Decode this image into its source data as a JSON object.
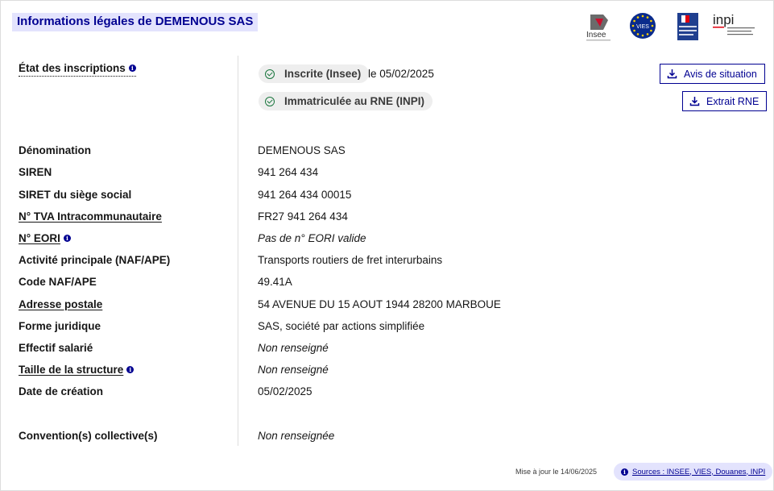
{
  "header": {
    "title": "Informations légales de DEMENOUS SAS",
    "logos": {
      "insee": "Insee",
      "vies": "VIES",
      "douanes": "DOUANES & DROITS INDIRECTS",
      "inpi": "inpi"
    }
  },
  "inscriptions": {
    "label": "État des inscriptions",
    "insee_badge": "Inscrite (Insee)",
    "insee_date": "le 05/02/2025",
    "rne_badge": "Immatriculée au RNE (INPI)",
    "avis_button": "Avis de situation",
    "extrait_button": "Extrait RNE"
  },
  "fields": [
    {
      "label": "Dénomination",
      "value": "DEMENOUS SAS"
    },
    {
      "label": "SIREN",
      "value": "941 264 434"
    },
    {
      "label": "SIRET du siège social",
      "value": "941 264 434 00015"
    },
    {
      "label": "N° TVA Intracommunautaire",
      "value": "FR27 941 264 434"
    },
    {
      "label": "N° EORI",
      "value": "Pas de n° EORI valide"
    },
    {
      "label": "Activité principale (NAF/APE)",
      "value": "Transports routiers de fret interurbains"
    },
    {
      "label": "Code NAF/APE",
      "value": "49.41A"
    },
    {
      "label": "Adresse postale",
      "value": "54 AVENUE DU 15 AOUT 1944 28200 MARBOUE"
    },
    {
      "label": "Forme juridique",
      "value": "SAS, société par actions simplifiée"
    },
    {
      "label": "Effectif salarié",
      "value": "Non renseigné"
    },
    {
      "label": "Taille de la structure",
      "value": "Non renseigné"
    },
    {
      "label": "Date de création",
      "value": "05/02/2025"
    },
    {
      "label": "Convention(s) collective(s)",
      "value": "Non renseignée"
    }
  ],
  "footer": {
    "updated": "Mise à jour le 14/06/2025",
    "sources": "Sources : INSEE, VIES, Douanes, INPI"
  },
  "colors": {
    "accent": "#000091",
    "accent_light": "#e3e3fd",
    "success": "#18753c"
  }
}
